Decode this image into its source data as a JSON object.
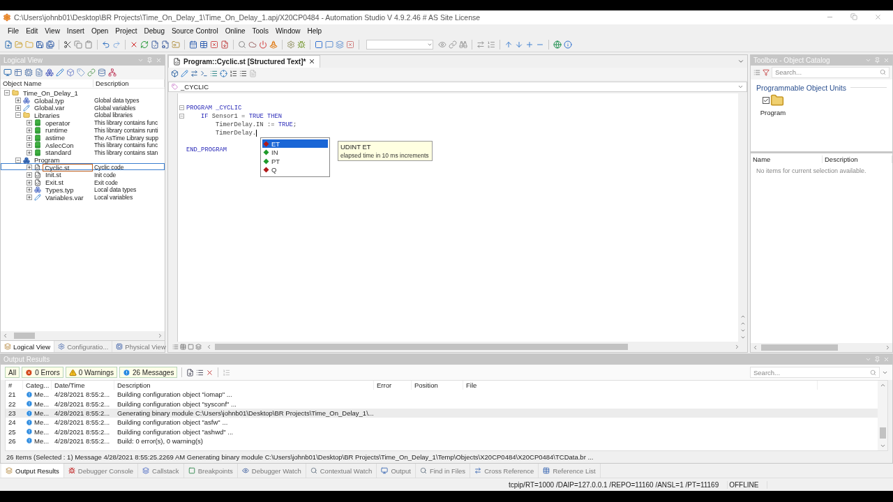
{
  "window": {
    "title": "C:\\Users\\johnb01\\Desktop\\BR Projects\\Time_On_Delay_1\\Time_On_Delay_1.apj/X20CP0484 - Automation Studio V 4.9.2.46 # AS Site License"
  },
  "menu": [
    "File",
    "Edit",
    "View",
    "Insert",
    "Open",
    "Project",
    "Debug",
    "Source Control",
    "Online",
    "Tools",
    "Window",
    "Help"
  ],
  "logical_view": {
    "title": "Logical View",
    "columns": [
      "Object Name",
      "Description"
    ],
    "tree": [
      {
        "name": "Time_On_Delay_1",
        "kind": "folder",
        "expanded": true,
        "selected": false,
        "children": [
          {
            "name": "Global.typ",
            "description": "Global data types",
            "kind": "types",
            "expanded": false,
            "selected": false
          },
          {
            "name": "Global.var",
            "description": "Global variables",
            "kind": "variables",
            "expanded": false,
            "selected": false
          },
          {
            "name": "Libraries",
            "description": "Global libraries",
            "kind": "folder",
            "expanded": true,
            "selected": false,
            "children": [
              {
                "name": "operator",
                "description": "This library contains func",
                "kind": "library",
                "expanded": false,
                "selected": false
              },
              {
                "name": "runtime",
                "description": "This library contains runti",
                "kind": "library",
                "expanded": false,
                "selected": false
              },
              {
                "name": "astime",
                "description": "The AsTime Library supp",
                "kind": "library",
                "expanded": false,
                "selected": false
              },
              {
                "name": "AslecCon",
                "description": "This library contains func",
                "kind": "library",
                "expanded": false,
                "selected": false
              },
              {
                "name": "standard",
                "description": "This library contains stan",
                "kind": "library",
                "expanded": false,
                "selected": false
              }
            ]
          },
          {
            "name": "Program",
            "kind": "program",
            "expanded": true,
            "selected": false,
            "children": [
              {
                "name": "Cyclic.st",
                "description": "Cyclic code",
                "kind": "source",
                "expanded": false,
                "selected": true
              },
              {
                "name": "Init.st",
                "description": "Init code",
                "kind": "source",
                "expanded": false,
                "selected": false
              },
              {
                "name": "Exit.st",
                "description": "Exit code",
                "kind": "source",
                "expanded": false,
                "selected": false
              },
              {
                "name": "Types.typ",
                "description": "Local data types",
                "kind": "types",
                "expanded": false,
                "selected": false
              },
              {
                "name": "Variables.var",
                "description": "Local variables",
                "kind": "variables",
                "expanded": false,
                "selected": false
              }
            ]
          }
        ]
      }
    ],
    "tabs": [
      {
        "label": "Logical View",
        "selected": true
      },
      {
        "label": "Configuratio...",
        "selected": false
      },
      {
        "label": "Physical View",
        "selected": false
      }
    ]
  },
  "editor": {
    "tab": "Program::Cyclic.st [Structured Text]*",
    "scope": "_CYCLIC",
    "lines": [
      {
        "kind": "code",
        "fold": true,
        "tokens": [
          {
            "text": "PROGRAM _CYCLIC",
            "kind": "keyword"
          }
        ],
        "children": [
          {
            "kind": "code",
            "fold": true,
            "tokens": [
              {
                "text": "IF",
                "kind": "keyword"
              },
              {
                "text": " Sensor1 = ",
                "kind": "plain"
              },
              {
                "text": "TRUE THEN",
                "kind": "keyword"
              }
            ],
            "children": [
              {
                "kind": "code",
                "fold": false,
                "tokens": [
                  {
                    "text": "TimerDelay.IN := ",
                    "kind": "plain"
                  },
                  {
                    "text": "TRUE",
                    "kind": "keyword"
                  },
                  {
                    "text": ";",
                    "kind": "plain"
                  }
                ]
              },
              {
                "kind": "code",
                "fold": false,
                "cursor": true,
                "tokens": [
                  {
                    "text": "TimerDelay.",
                    "kind": "plain"
                  }
                ]
              }
            ]
          }
        ]
      },
      {
        "kind": "blank"
      },
      {
        "kind": "code",
        "fold": false,
        "tokens": [
          {
            "text": "END_PROGRAM",
            "kind": "keyword"
          }
        ]
      }
    ],
    "autocomplete": {
      "items": [
        {
          "label": "ET",
          "kind": "output",
          "selected": true
        },
        {
          "label": "IN",
          "kind": "input",
          "selected": false
        },
        {
          "label": "PT",
          "kind": "input",
          "selected": false
        },
        {
          "label": "Q",
          "kind": "output",
          "selected": false
        }
      ],
      "tooltip": {
        "title": "UDINT ET",
        "text": "elapsed time in 10 ms increments"
      }
    }
  },
  "toolbox": {
    "title": "Toolbox - Object Catalog",
    "search": {
      "placeholder": "Search..."
    },
    "group": "Programmable Object Units",
    "items": [
      {
        "label": "Program",
        "checked": true
      }
    ],
    "columns": [
      "Name",
      "Description"
    ],
    "empty_message": "No items for current selection available."
  },
  "output": {
    "title": "Output Results",
    "filters": [
      {
        "label": "All",
        "kind": "all"
      },
      {
        "label": "0 Errors",
        "kind": "error"
      },
      {
        "label": "0 Warnings",
        "kind": "warning"
      },
      {
        "label": "26 Messages",
        "kind": "message"
      }
    ],
    "search": {
      "placeholder": "Search..."
    },
    "columns": [
      "#",
      "Categ...",
      "Date/Time",
      "Description",
      "Error",
      "Position",
      "File"
    ],
    "rows": [
      {
        "cells": [
          "21",
          "Me...",
          "4/28/2021 8:55:2...",
          "Building configuration object \"iomap\" ..."
        ],
        "selected": false
      },
      {
        "cells": [
          "22",
          "Me...",
          "4/28/2021 8:55:2...",
          "Building configuration object \"sysconf\" ..."
        ],
        "selected": false
      },
      {
        "cells": [
          "23",
          "Me...",
          "4/28/2021 8:55:2...",
          "Generating binary module C:\\Users\\johnb01\\Desktop\\BR Projects\\Time_On_Delay_1\\..."
        ],
        "selected": true
      },
      {
        "cells": [
          "24",
          "Me...",
          "4/28/2021 8:55:2...",
          "Building configuration object \"asfw\" ..."
        ],
        "selected": false
      },
      {
        "cells": [
          "25",
          "Me...",
          "4/28/2021 8:55:2...",
          "Building configuration object \"ashwd\" ..."
        ],
        "selected": false
      },
      {
        "cells": [
          "26",
          "Me...",
          "4/28/2021 8:55:2...",
          "Build: 0 error(s), 0 warning(s)"
        ],
        "selected": false
      }
    ],
    "summary": "26 Items (Selected : 1)  Message 4/28/2021 8:55:25.2269 AM Generating binary module C:\\Users\\johnb01\\Desktop\\BR Projects\\Time_On_Delay_1\\Temp\\Objects\\X20CP0484\\X20CP0484\\TCData.br ..."
  },
  "bottom_tabs": [
    {
      "label": "Output Results",
      "selected": true
    },
    {
      "label": "Debugger Console",
      "selected": false
    },
    {
      "label": "Callstack",
      "selected": false
    },
    {
      "label": "Breakpoints",
      "selected": false
    },
    {
      "label": "Debugger Watch",
      "selected": false
    },
    {
      "label": "Contextual Watch",
      "selected": false
    },
    {
      "label": "Output",
      "selected": false
    },
    {
      "label": "Find in Files",
      "selected": false
    },
    {
      "label": "Cross Reference",
      "selected": false
    },
    {
      "label": "Reference List",
      "selected": false
    }
  ],
  "status_bar": {
    "connection": "tcpip/RT=1000 /DAIP=127.0.0.1 /REPO=11160 /ANSL=1 /PT=11169",
    "state": "OFFLINE"
  }
}
